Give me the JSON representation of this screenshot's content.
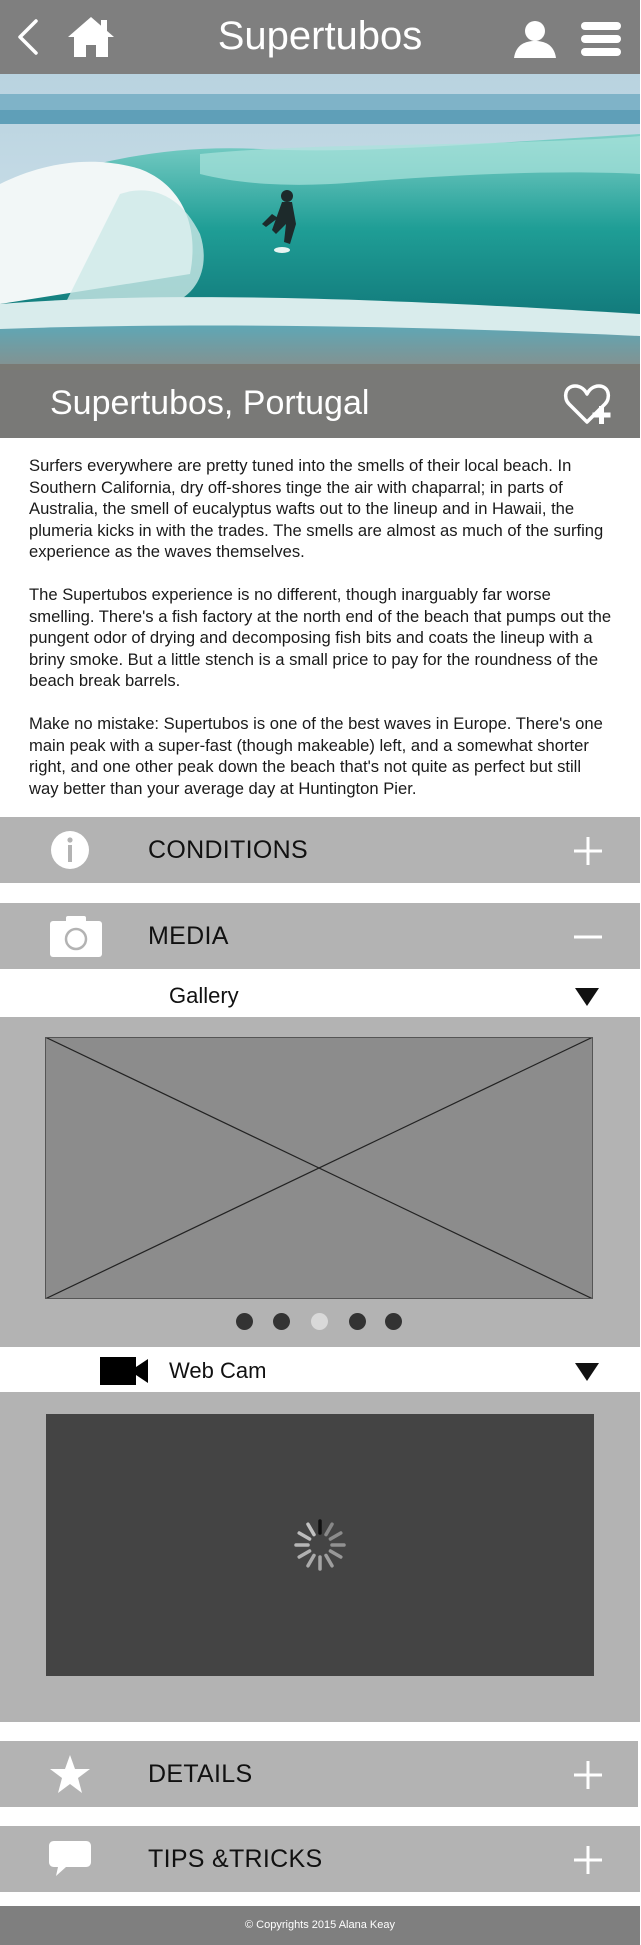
{
  "header": {
    "title": "Supertubos",
    "back_icon": "chevron-left-icon",
    "home_icon": "home-icon",
    "profile_icon": "user-icon",
    "menu_icon": "hamburger-menu-icon"
  },
  "hero": {
    "caption": "Supertubos, Portugal",
    "favorite_icon": "heart-plus-icon"
  },
  "article": {
    "paragraphs": [
      "Surfers everywhere are pretty tuned into the smells of their local beach. In Southern California, dry off-shores tinge the air with chaparral; in parts of Australia, the smell of eucalyptus wafts out to the lineup and in Hawaii, the plumeria kicks in with the trades. The smells are almost as much of the surfing experience as the waves themselves.",
      "The Supertubos experience is no different, though inarguably far worse smelling. There's a fish factory at the north end of the beach that pumps out the pungent odor of drying and decomposing fish bits and coats the lineup with a briny smoke. But a little stench is a small price to pay for the roundness of the beach break barrels.",
      "Make no mistake: Supertubos is one of the best waves in Europe. There's one main peak with a super-fast (though makeable) left, and a somewhat shorter right, and one other peak down the beach that's not quite as perfect but still way better than your average day at Huntington Pier."
    ]
  },
  "sections": {
    "conditions": {
      "label": "CONDITIONS",
      "icon": "info-icon",
      "state": "collapsed"
    },
    "media": {
      "label": "MEDIA",
      "icon": "camera-icon",
      "state": "expanded"
    },
    "details": {
      "label": "DETAILS",
      "icon": "star-icon",
      "state": "collapsed"
    },
    "tips": {
      "label": "TIPS &TRICKS",
      "icon": "speech-bubble-icon",
      "state": "collapsed"
    }
  },
  "media": {
    "gallery": {
      "label": "Gallery",
      "slide_count": 5,
      "active_slide": 3
    },
    "webcam": {
      "label": "Web Cam",
      "icon": "video-camera-icon",
      "status": "loading"
    }
  },
  "footer": {
    "copyright": "© Copyrights 2015 Alana Keay"
  },
  "colors": {
    "header_bg": "#7f7f7f",
    "section_bg": "#b3b3b3",
    "placeholder_bg": "#8c8c8c",
    "webcam_bg": "#444444"
  }
}
